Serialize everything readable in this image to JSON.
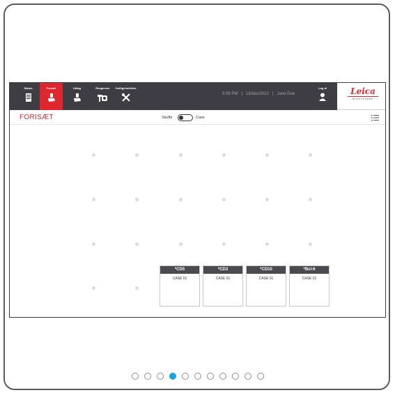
{
  "nav": {
    "items": [
      {
        "label": "Status",
        "icon": "tissue-cassette-icon",
        "active": false
      },
      {
        "label": "Forsæt",
        "icon": "hand-slide-icon",
        "active": true
      },
      {
        "label": "Udtag",
        "icon": "hand-slide-icon",
        "active": false
      },
      {
        "label": "Reagenser",
        "icon": "reagent-bottle-icon",
        "active": false
      },
      {
        "label": "Vedligeholdelse",
        "icon": "tools-icon",
        "active": false
      }
    ]
  },
  "status": {
    "time": "5:08 PM",
    "date": "13/dec/2022",
    "user": "Jane Doe"
  },
  "logout": {
    "label": "Log af",
    "icon": "user-icon"
  },
  "brand": {
    "name": "Leica",
    "subtitle": "BIOSYSTEMS",
    "color": "#e0262f"
  },
  "page": {
    "title": "FORISÆT"
  },
  "toggle": {
    "left_label": "Skuffe",
    "right_label": "Case",
    "state": "off"
  },
  "menu": {
    "icon": "list-menu-icon"
  },
  "slides": [
    {
      "marker": "*CD5",
      "case": "CASE 01"
    },
    {
      "marker": "*CD3",
      "case": "CASE 01"
    },
    {
      "marker": "*CD10",
      "case": "CASE 01"
    },
    {
      "marker": "*Bcl-6",
      "case": "CASE 01"
    }
  ],
  "pager": {
    "count": 11,
    "active": 4
  },
  "colors": {
    "accent": "#e0262f",
    "topbar": "#3d3d43",
    "pager_active": "#1aa3dc"
  }
}
